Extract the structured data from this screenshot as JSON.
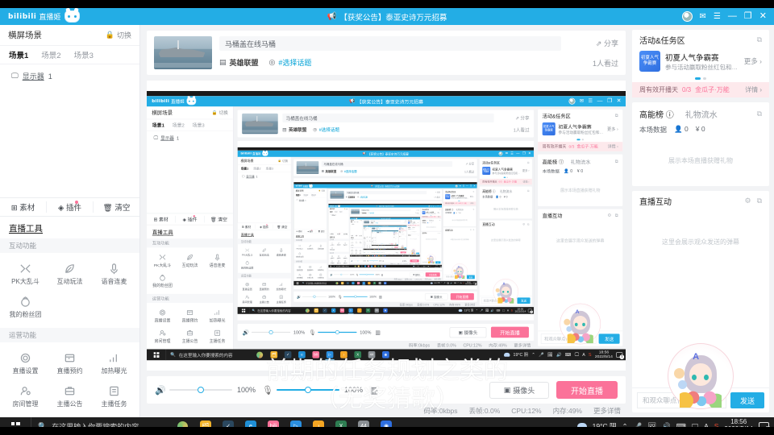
{
  "window": {
    "app_name_logo": "bilibili",
    "app_name": "直播姬",
    "notice": "【获奖公告】泰亚史诗万元招募",
    "notice_icon": "megaphone-icon",
    "mail_icon": "mail-icon",
    "menu_icon": "hamburger-menu-icon",
    "minimize": "—",
    "maximize": "❐",
    "close": "✕"
  },
  "scene_panel": {
    "title": "横屏场景",
    "switch_label": "切换",
    "lock_icon": "lock-icon",
    "tabs": [
      "场景1",
      "场景2",
      "场景3"
    ],
    "active_tab": "场景1",
    "sources": [
      {
        "icon": "monitor-icon",
        "label": "显示器",
        "index": "1"
      }
    ]
  },
  "source_bar": {
    "items": [
      {
        "label": "素材",
        "icon": "layers-icon",
        "badge": false
      },
      {
        "label": "插件",
        "icon": "plugin-icon",
        "badge": true
      },
      {
        "label": "清空",
        "icon": "trash-icon",
        "badge": false
      }
    ]
  },
  "live_tools": {
    "title": "直播工具",
    "groups": [
      {
        "name": "互动功能",
        "items": [
          {
            "label": "PK大乱斗",
            "icon": "pk-icon"
          },
          {
            "label": "互动玩法",
            "icon": "leaf-icon"
          },
          {
            "label": "语音连麦",
            "icon": "microphone-icon"
          },
          {
            "label": "我的粉丝团",
            "icon": "fanclub-icon"
          }
        ]
      },
      {
        "name": "运营功能",
        "items": [
          {
            "label": "直播设置",
            "icon": "gear-icon"
          },
          {
            "label": "直播预约",
            "icon": "calendar-icon"
          },
          {
            "label": "加热曝光",
            "icon": "bar-chart-icon"
          },
          {
            "label": "房间管理",
            "icon": "user-manage-icon"
          },
          {
            "label": "主播公告",
            "icon": "announcement-icon"
          },
          {
            "label": "主播任务",
            "icon": "task-list-icon"
          }
        ]
      }
    ]
  },
  "stream_info": {
    "cover_alt": "warship-cover-image",
    "title_value": "马桶盖在线马桶",
    "area_icon": "game-icon",
    "area_label": "英雄联盟",
    "topic_icon": "topic-icon",
    "topic_label": "#选择话题",
    "share_label": "分享",
    "share_icon": "share-icon",
    "viewers_label": "1人看过"
  },
  "bottom_bar": {
    "speaker_icon": "speaker-icon",
    "speaker_value": "100%",
    "mic_icon": "microphone-icon",
    "mic_value": "100%",
    "levels_icon": "audio-levels-icon",
    "camera_button": "摄像头",
    "camera_icon": "camera-icon",
    "start_live_button": "开始直播"
  },
  "status_bar": {
    "bitrate": "码率:0kbps",
    "dropped": "丢帧:0.0%",
    "cpu": "CPU:12%",
    "memory": "内存:49%",
    "more": "更多详情"
  },
  "activity_panel": {
    "title": "活动&任务区",
    "expand_icon": "popout-icon",
    "badge_line1": "初夏人气",
    "badge_line2": "争霸赛",
    "activity_title": "初夏人气争霸赛",
    "activity_desc": "参与活动赢取粉丝红包和高额...",
    "more_label": "更多 ›",
    "task_text": "周有效开播天",
    "task_progress": "0/3",
    "task_reward": "金瓜子·万能",
    "task_detail": "详情 ›"
  },
  "rank_panel": {
    "tab_primary": "高能榜",
    "info_icon": "info-icon",
    "tab_secondary": "礼物流水",
    "expand_icon": "popout-icon",
    "stat_label": "本场数据",
    "viewers_icon": "person-icon",
    "viewers_value": "0",
    "coins_icon": "coin-icon",
    "coins_value": "0",
    "empty_note": "展示本场直播获赠礼物"
  },
  "interaction_panel": {
    "title": "直播互动",
    "gear_icon": "gear-icon",
    "expand_icon": "popout-icon",
    "empty_note": "这里会展示观众发送的弹幕",
    "chibi_alt": "anime-mascot-illustration"
  },
  "chat": {
    "placeholder": "和观众聊点什么吧~",
    "send_label": "发送"
  },
  "subtitles": {
    "line1": "前期的任务规划之类的",
    "line2": "（无奖猜歌）"
  },
  "taskbar": {
    "start_icon": "windows-start-icon",
    "search_placeholder": "在这里输入你要搜索的内容",
    "search_icon": "search-icon",
    "cortana_icon": "cortana-icon",
    "apps": [
      {
        "name": "file-explorer-icon",
        "glyph": "🗂",
        "color": "#f2b32b"
      },
      {
        "name": "steam-icon",
        "glyph": "✓",
        "color": "#2a475e"
      },
      {
        "name": "edge-browser-icon",
        "glyph": "e",
        "color": "#1f8fd6"
      },
      {
        "name": "bilibili-icon",
        "glyph": "bili",
        "color": "#fb7299"
      },
      {
        "name": "bililive-icon",
        "glyph": "▷",
        "color": "#2a8fe0"
      },
      {
        "name": "qq-music-icon",
        "glyph": "♪",
        "color": "#f5a623"
      },
      {
        "name": "excel-icon",
        "glyph": "X",
        "color": "#2e7d52"
      },
      {
        "name": "notes-icon",
        "glyph": "44",
        "color": "#8a8f94"
      },
      {
        "name": "capture-icon",
        "glyph": "◉",
        "color": "#2f6fe0"
      }
    ],
    "tray": {
      "weather_icon": "cloud-icon",
      "weather": "19°C 阴",
      "chevron_icon": "chevron-up-icon",
      "mic_icon": "microphone-icon",
      "screenshot_icon": "screenshot-icon",
      "volume_icon": "volume-icon",
      "keyboard_icon": "keyboard-icon",
      "display_icon": "display-icon",
      "ime_label": "A",
      "sogou_icon": "sogou-ime-icon",
      "time": "18:56",
      "date": "2022/5/14",
      "notification_icon": "notification-icon",
      "notification_count": "1"
    }
  },
  "colors": {
    "brand_blue": "#23ade5",
    "brand_pink": "#fb7299",
    "panel_bg": "#f2f3f5"
  }
}
